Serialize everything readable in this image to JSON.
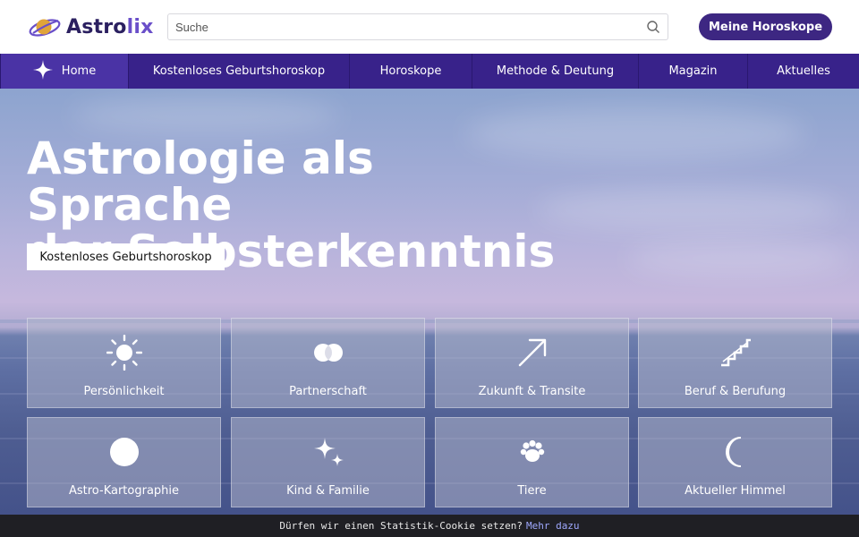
{
  "brand": {
    "name_part1": "Astro",
    "name_part2": "lix"
  },
  "search": {
    "placeholder": "Suche"
  },
  "header": {
    "my_horoscopes": "Meine Horoskope"
  },
  "nav": {
    "items": [
      {
        "label": "Home",
        "icon": "star-icon"
      },
      {
        "label": "Kostenloses Geburtshoroskop"
      },
      {
        "label": "Horoskope"
      },
      {
        "label": "Methode & Deutung"
      },
      {
        "label": "Magazin"
      },
      {
        "label": "Aktuelles"
      }
    ]
  },
  "hero": {
    "title_line1": "Astrologie als Sprache",
    "title_line2": "der Selbsterkenntnis",
    "cta": "Kostenloses Geburtshoroskop"
  },
  "tiles": [
    {
      "label": "Persönlichkeit",
      "icon": "sun-icon"
    },
    {
      "label": "Partnerschaft",
      "icon": "rings-icon"
    },
    {
      "label": "Zukunft & Transite",
      "icon": "arrow-up-right-icon"
    },
    {
      "label": "Beruf & Berufung",
      "icon": "stairs-icon"
    },
    {
      "label": "Astro-Kartographie",
      "icon": "globe-icon"
    },
    {
      "label": "Kind & Familie",
      "icon": "sparkles-icon"
    },
    {
      "label": "Tiere",
      "icon": "paw-icon"
    },
    {
      "label": "Aktueller Himmel",
      "icon": "moon-icon"
    }
  ],
  "cookie": {
    "text": "Dürfen wir einen Statistik-Cookie setzen?",
    "link": "Mehr dazu"
  },
  "colors": {
    "primary": "#38228a",
    "button": "#3d2782",
    "accent": "#6a4fc9"
  }
}
